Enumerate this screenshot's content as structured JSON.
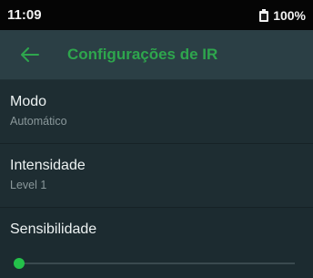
{
  "status_bar": {
    "time": "11:09",
    "battery_percent": "100%",
    "battery_icon": "battery-full-icon"
  },
  "app_bar": {
    "back_icon": "arrow-left-icon",
    "title": "Configurações de IR",
    "accent_color": "#2ea64d"
  },
  "settings": {
    "mode": {
      "title": "Modo",
      "value": "Automático"
    },
    "intensity": {
      "title": "Intensidade",
      "value": "Level 1"
    },
    "sensitivity": {
      "title": "Sensibilidade",
      "slider_value_fraction": 0.0,
      "thumb_color": "#24c04a"
    }
  }
}
